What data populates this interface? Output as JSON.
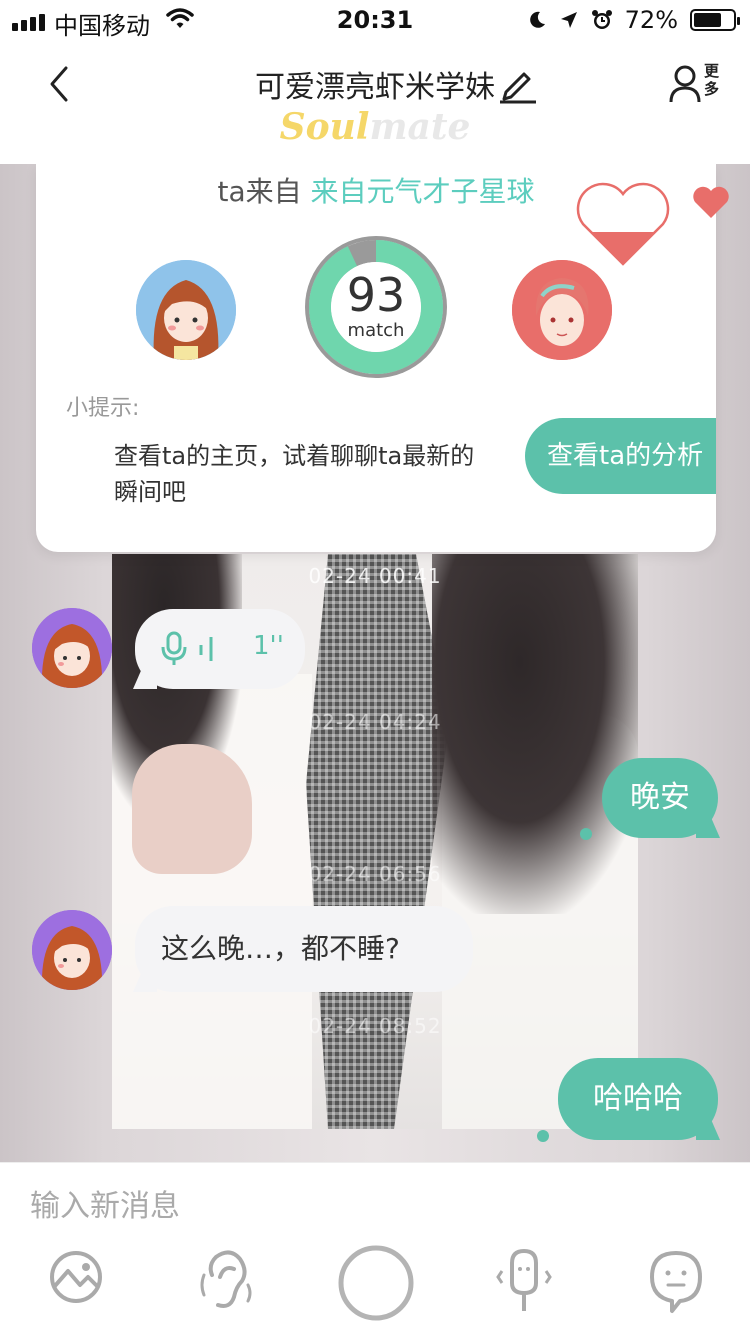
{
  "status_bar": {
    "carrier": "中国移动",
    "time": "20:31",
    "battery": "72%",
    "battery_level": 0.72,
    "icons": [
      "signal-icon",
      "wifi-icon",
      "moon-icon",
      "location-icon",
      "alarm-icon",
      "battery-icon"
    ]
  },
  "header": {
    "title": "可爱漂亮虾米学妹",
    "more_label": "更多",
    "logo_part1": "Soul",
    "logo_part2": "mate"
  },
  "match_card": {
    "from_prefix": "ta来自",
    "planet": "来自元气才子星球",
    "score": "93",
    "score_label": "match",
    "score_fraction": 0.93,
    "tip_label": "小提示:",
    "tip_text": "查看ta的主页，试着聊聊ta最新的瞬间吧",
    "analysis_button": "查看ta的分析"
  },
  "messages": [
    {
      "type": "timestamp",
      "text": "02-24 00:41"
    },
    {
      "type": "voice",
      "side": "in",
      "duration": "1''"
    },
    {
      "type": "timestamp",
      "text": "02-24 04:24"
    },
    {
      "type": "text",
      "side": "out",
      "text": "晚安"
    },
    {
      "type": "timestamp",
      "text": "02-24 06:56"
    },
    {
      "type": "text",
      "side": "in",
      "text": "这么晚…，都不睡?"
    },
    {
      "type": "timestamp",
      "text": "02-24 08:52"
    },
    {
      "type": "text",
      "side": "out",
      "text": "哈哈哈"
    }
  ],
  "input": {
    "placeholder": "输入新消息"
  },
  "toolbar": {
    "items": [
      "image-icon",
      "ear-icon",
      "record-button-icon",
      "voice-changer-icon",
      "emoji-icon"
    ]
  },
  "colors": {
    "accent": "#5cc1aa",
    "planet_text": "#5ccdbe",
    "heart": "#e86e6a"
  }
}
